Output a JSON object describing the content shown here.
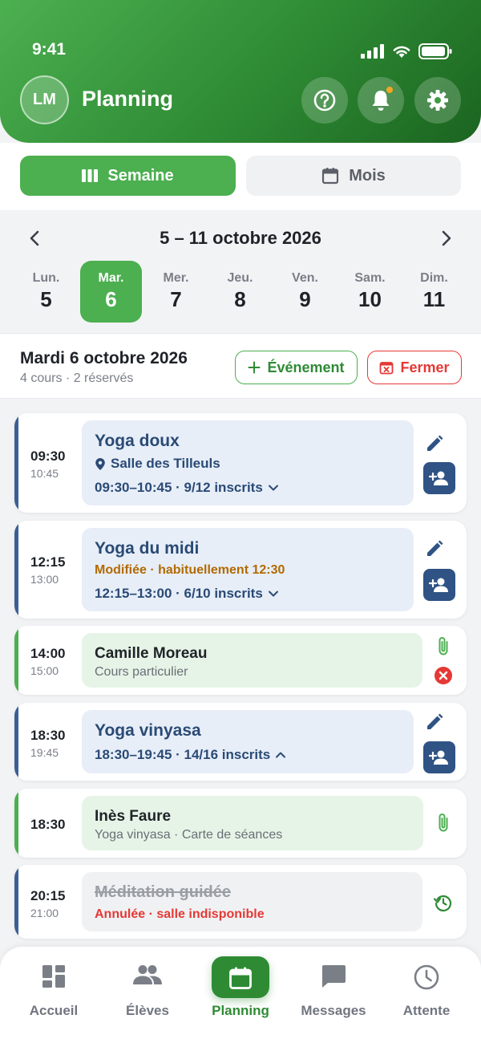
{
  "status_bar": {
    "time": "9:41"
  },
  "header": {
    "avatar_initials": "LM",
    "title": "Planning"
  },
  "view_toggle": {
    "week_label": "Semaine",
    "month_label": "Mois",
    "selected": "week"
  },
  "week": {
    "range": "5 – 11 octobre 2026",
    "days": [
      {
        "name": "Lun.",
        "num": "5"
      },
      {
        "name": "Mar.",
        "num": "6",
        "selected": true
      },
      {
        "name": "Mer.",
        "num": "7"
      },
      {
        "name": "Jeu.",
        "num": "8"
      },
      {
        "name": "Ven.",
        "num": "9"
      },
      {
        "name": "Sam.",
        "num": "10"
      },
      {
        "name": "Dim.",
        "num": "11"
      }
    ]
  },
  "day_header": {
    "title": "Mardi 6 octobre 2026",
    "summary": "4 cours · 2 réservés",
    "add_event_label": "Événement",
    "close_label": "Fermer"
  },
  "events": [
    {
      "start": "09:30",
      "end": "10:45",
      "title": "Yoga doux",
      "location": "Salle des Tilleuls",
      "detail": "09:30–10:45 · 9/12 inscrits"
    },
    {
      "start": "12:15",
      "end": "13:00",
      "title": "Yoga du midi",
      "note": "Modifiée · habituellement 12:30",
      "detail": "12:15–13:00 · 6/10 inscrits"
    },
    {
      "start": "14:00",
      "end": "15:00",
      "title": "Camille Moreau",
      "subtitle": "Cours particulier"
    },
    {
      "start": "18:30",
      "end": "19:45",
      "title": "Yoga vinyasa",
      "detail": "18:30–19:45 · 14/16 inscrits"
    },
    {
      "start": "18:30",
      "title": "Inès Faure",
      "subtitle": "Yoga vinyasa · Carte de séances"
    },
    {
      "start": "20:15",
      "end": "21:00",
      "title": "Méditation guidée",
      "note": "Annulée · salle indisponible"
    }
  ],
  "bottom_nav": [
    {
      "label": "Accueil",
      "icon": "dashboard-icon"
    },
    {
      "label": "Élèves",
      "icon": "people-icon"
    },
    {
      "label": "Planning",
      "icon": "calendar-icon",
      "active": true
    },
    {
      "label": "Messages",
      "icon": "chat-icon"
    },
    {
      "label": "Attente",
      "icon": "clock-icon"
    }
  ],
  "colors": {
    "primary": "#4caf50",
    "primary_dark": "#2e8b34",
    "course": "#3b5f93",
    "danger": "#e53935",
    "warning": "#b26a00"
  }
}
